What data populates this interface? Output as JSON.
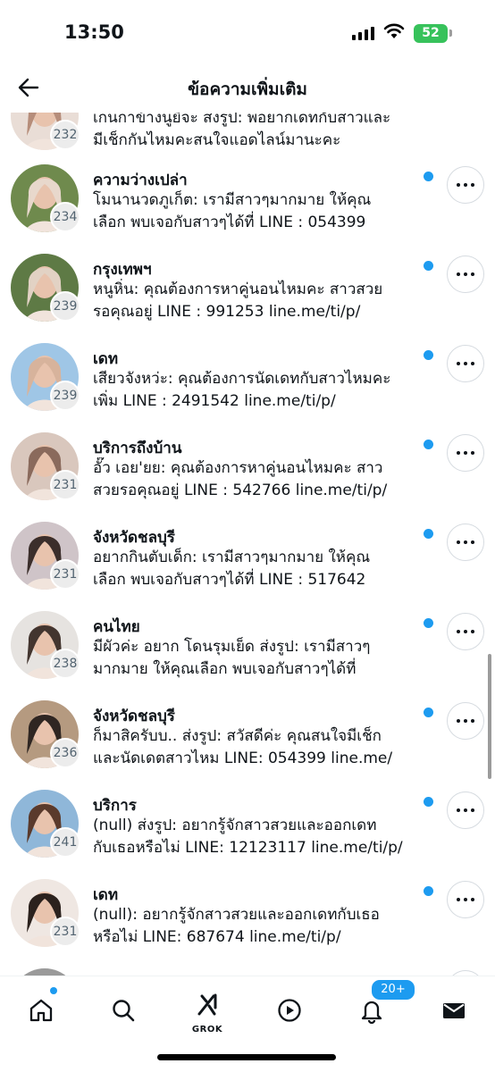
{
  "status_bar": {
    "time": "13:50",
    "battery": "52",
    "icons": [
      "signal-icon",
      "wifi-icon",
      "battery-icon"
    ]
  },
  "header": {
    "title": "ข้อความเพิ่มเติม",
    "back_icon": "back-arrow-icon"
  },
  "messages": [
    {
      "count": "232",
      "title": "",
      "snippet_lines": [
        "เก่นกาข้างนูยิจะ ส่งรูป: พ่อยากเดทกับสาวและ",
        "มีเช็กกันไหมคะสนใจแอดไลน์มานะคะ"
      ],
      "unread": false,
      "avatar_colors": [
        "#e9ddd6",
        "#b68d7a"
      ]
    },
    {
      "count": "234",
      "title": "ความว่างเปล่า",
      "snippet_lines": [
        "โมนานวดภูเก็ต: เรามีสาวๆมากมาย ให้คุณ",
        "เลือก พบเจอกับสาวๆได้ที่   LINE : 054399"
      ],
      "unread": true,
      "avatar_colors": [
        "#6f8a4d",
        "#e8d8cc"
      ]
    },
    {
      "count": "239",
      "title": "กรุงเทพฯ",
      "snippet_lines": [
        "หนูหิ่น: คุณต้องการหาคู่นอนไหมคะ สาวสวย",
        "รอคุณอยู่  LINE : 991253 line.me/ti/p/"
      ],
      "unread": true,
      "avatar_colors": [
        "#5e7a45",
        "#e2d2c4"
      ]
    },
    {
      "count": "239",
      "title": "เดท",
      "snippet_lines": [
        "เสียวจังหว่ะ: คุณต้องการนัดเดทกับสาวไหมคะ",
        "เพิ่ม  LINE : 2491542 line.me/ti/p/"
      ],
      "unread": true,
      "avatar_colors": [
        "#9fc6e6",
        "#d7b39c"
      ]
    },
    {
      "count": "231",
      "title": "บริการถึงบ้าน",
      "snippet_lines": [
        "อั๊ว เอย'ยย: คุณต้องการหาคู่นอนไหมคะ สาว",
        "สวยรอคุณอยู่  LINE : 542766 line.me/ti/p/"
      ],
      "unread": true,
      "avatar_colors": [
        "#d9c7bd",
        "#8a6a5c"
      ]
    },
    {
      "count": "231",
      "title": "จังหวัดชลบุรี",
      "snippet_lines": [
        "อยากกินตับเด็ก: เรามีสาวๆมากมาย ให้คุณ",
        "เลือก พบเจอกับสาวๆได้ที่   LINE : 517642"
      ],
      "unread": true,
      "avatar_colors": [
        "#cfc4c8",
        "#3b2e2b"
      ]
    },
    {
      "count": "238",
      "title": "คนไทย",
      "snippet_lines": [
        "มีผัวค่ะ อยาก โดนรุมเย็ด ส่งรูป: เรามีสาวๆ",
        "มากมาย ให้คุณเลือก พบเจอกับสาวๆได้ที่"
      ],
      "unread": true,
      "avatar_colors": [
        "#e6e3e0",
        "#43352f"
      ]
    },
    {
      "count": "236",
      "title": "จังหวัดชลบุรี",
      "snippet_lines": [
        "ก็มาสิครับบ.. ส่งรูป: สวัสดีค่ะ คุณสนใจมีเช็ก",
        "และนัดเดตสาวไหม LINE: 054399 line.me/"
      ],
      "unread": true,
      "avatar_colors": [
        "#b59a80",
        "#2f2622"
      ]
    },
    {
      "count": "241",
      "title": "บริการ",
      "snippet_lines": [
        "(null) ส่งรูป: อยากรู้จักสาวสวยและออกเดท",
        "กับเธอหรือไม่  LINE: 12123117 line.me/ti/p/"
      ],
      "unread": true,
      "avatar_colors": [
        "#8fb7d9",
        "#5a3a2c"
      ]
    },
    {
      "count": "231",
      "title": "เดท",
      "snippet_lines": [
        "(null): อยากรู้จักสาวสวยและออกเดทกับเธอ",
        "หรือไม่  LINE: 687674 line.me/ti/p/"
      ],
      "unread": true,
      "avatar_colors": [
        "#efe7e2",
        "#2b211d"
      ]
    },
    {
      "count": "",
      "title": "",
      "snippet_lines": [
        "",
        ""
      ],
      "unread": true,
      "avatar_colors": [
        "#9a9a9a",
        "#555555"
      ]
    }
  ],
  "tab_bar": {
    "tabs": [
      "home-icon",
      "search-icon",
      "grok-icon",
      "video-play-icon",
      "notifications-bell-icon",
      "messages-mail-icon"
    ],
    "grok_label": "GROK",
    "notifications_badge": "20+"
  },
  "colors": {
    "accent": "#1d9bf0",
    "text": "#0f1419",
    "secondary": "#536471"
  }
}
